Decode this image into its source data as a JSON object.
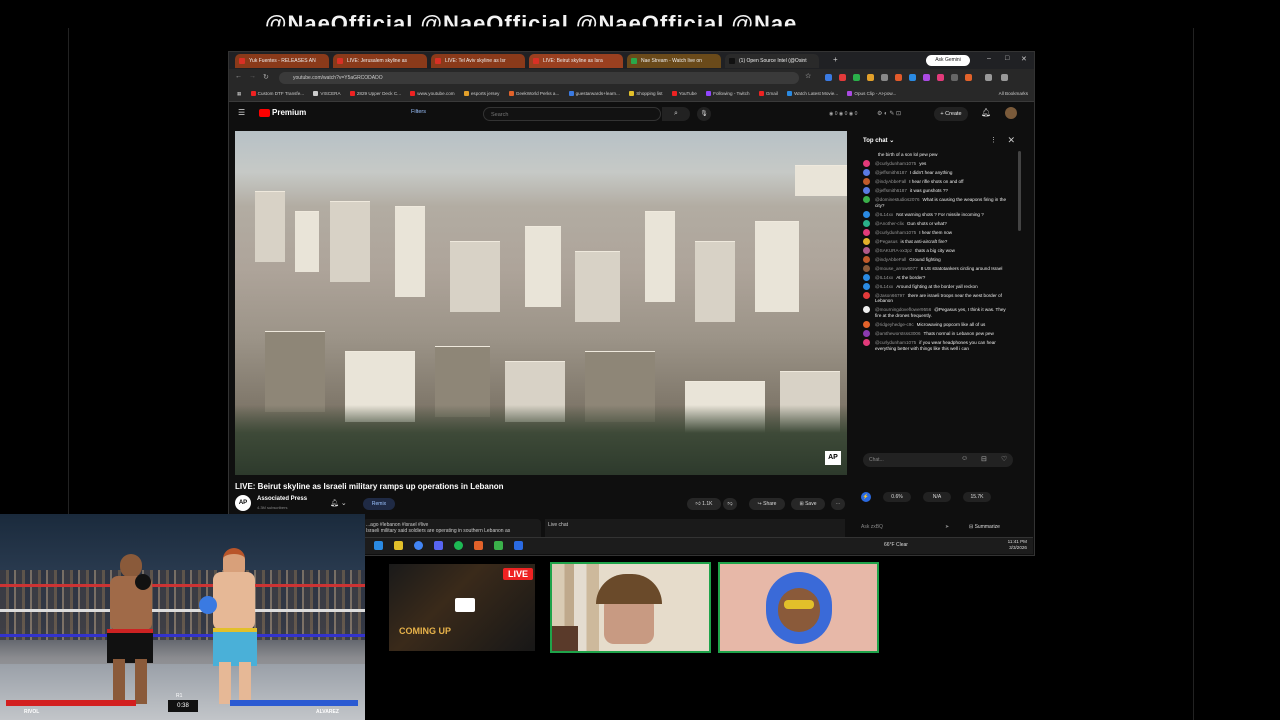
{
  "banner": {
    "text": "@NaeOfficial @NaeOfficial @NaeOfficial @Nae"
  },
  "browser": {
    "tabs": [
      {
        "label": "Yuk Fuentes - RELEASES AN",
        "color": "#d93025",
        "bg": "#8a3a1a"
      },
      {
        "label": "LIVE: Jerusalem skyline as",
        "color": "#d93025",
        "bg": "#8a3a1a"
      },
      {
        "label": "LIVE: Tel Aviv skyline as Isr",
        "color": "#d93025",
        "bg": "#8a3a1a"
      },
      {
        "label": "LIVE: Beirut skyline as Isra",
        "color": "#d93025",
        "bg": "#9a4020"
      },
      {
        "label": "Nae Stream - Watch live on",
        "color": "#2aa84a",
        "bg": "#6a4a1a"
      },
      {
        "label": "(1) Open Source Intel (@Osint",
        "color": "#111111",
        "bg": "#2a2a2a"
      }
    ],
    "gemini_label": "Ask Gemini",
    "url": "youtube.com/watch?v=Y5aGRCODADO",
    "bookmarks": [
      "Custom DTF Transfe...",
      "VISCERA",
      "2829 Upper Deck C...",
      "www.youtube.com",
      "esports jersey",
      "GeekWorld Perks a...",
      "guestarwards+learn...",
      "Shopping list",
      "YouTube",
      "Following - Twitch",
      "Gmail",
      "Watch Latest Movie...",
      "Opus Clip - AI-pow...",
      "All Bookmarks"
    ]
  },
  "youtube": {
    "logo": "Premium",
    "filters": "Filters",
    "search_placeholder": "Search",
    "create": "Create",
    "video_title": "LIVE: Beirut skyline as Israeli military ramps up operations in Lebanon",
    "channel": "Associated Press",
    "channel_badge": "AP",
    "subs": "4.3M subscribers",
    "remix": "Remix",
    "likes": "1.1K",
    "share": "Share",
    "save": "Save",
    "desc": "...ago #lebanon #israel #live\nIsraeli military said soldiers are operating in southern Lebanon as",
    "live_chat_label": "Live chat"
  },
  "chat": {
    "header": "Top chat",
    "messages": [
      {
        "user": "",
        "text": "the birth of a son lol pew pew",
        "color": "#9b59b6"
      },
      {
        "user": "@curlydunham1075",
        "text": "yes",
        "color": "#e23a7a"
      },
      {
        "user": "@jeffsmith6187",
        "text": "I didn't hear anything",
        "color": "#5a7ae2"
      },
      {
        "user": "@indyAbbeFall",
        "text": "I hear rifle shots on and off",
        "color": "#c05a2a"
      },
      {
        "user": "@jeffsmith6187",
        "text": "it was gunshots ??",
        "color": "#5a7ae2"
      },
      {
        "user": "@dominestudios2076",
        "text": "What is causing the weapons firing in the city?",
        "color": "#3ab04a"
      },
      {
        "user": "@IL14xx",
        "text": "Not warning shots ? For missile incoming ?",
        "color": "#2a8ae2"
      },
      {
        "user": "@Another-clix",
        "text": "Gun shots or what?",
        "color": "#2ab08a"
      },
      {
        "user": "@curlydunham1075",
        "text": "I hear them now",
        "color": "#e23a7a"
      },
      {
        "user": "@Pegasus",
        "text": "is that anti-aircraft fire?",
        "color": "#e2b02a"
      },
      {
        "user": "@SAKURA-xx3pz",
        "text": "thats a big city wow",
        "color": "#b05a8a"
      },
      {
        "user": "@indyAbbeFall",
        "text": "Ground fighting",
        "color": "#c05a2a"
      },
      {
        "user": "@mouse_arrow6077",
        "text": "8 US stratotankers circling around Israel",
        "color": "#8a5a3a"
      },
      {
        "user": "@IL14xx",
        "text": "At the border?",
        "color": "#2a8ae2"
      },
      {
        "user": "@IL14xx",
        "text": "Around fighting at the border yall reckon",
        "color": "#2a8ae2"
      },
      {
        "user": "@Jason66797",
        "text": "there are israeli troops near the west border of Lebanon",
        "color": "#e23a3a"
      },
      {
        "user": "@mourningdoveflower9556",
        "text": "@Pegasus yes, I think it was. They fire at the drones frequently.",
        "color": "#eeeeee"
      },
      {
        "user": "@ridgeyhedge-c9c",
        "text": "Microwaving popcorn like all of us",
        "color": "#e2622a"
      },
      {
        "user": "@amtheworstsss3006",
        "text": "Thats normal in Lebanon pew pew",
        "color": "#8a3ab0"
      },
      {
        "user": "@curlydunham1075",
        "text": "if you wear headphones you can hear everything better with things like this well i can",
        "color": "#e23a7a"
      }
    ],
    "input_placeholder": "Chat...",
    "stats": [
      "0.6%",
      "N/A",
      "15.7K"
    ],
    "ask_placeholder": "Ask zxBQ",
    "summarize": "Summarize"
  },
  "taskbar": {
    "weather": "66°F Clear",
    "time": "11:41 PM",
    "date": "3/3/2026"
  },
  "game": {
    "p1": "RIVOL",
    "p2": "ALVAREZ",
    "round": "R1",
    "clock": "0:38",
    "p1_color": "#d21f1f",
    "p2_color": "#2a5ad2"
  },
  "cams": {
    "live_label": "LIVE",
    "coming_up": "COMING UP"
  }
}
